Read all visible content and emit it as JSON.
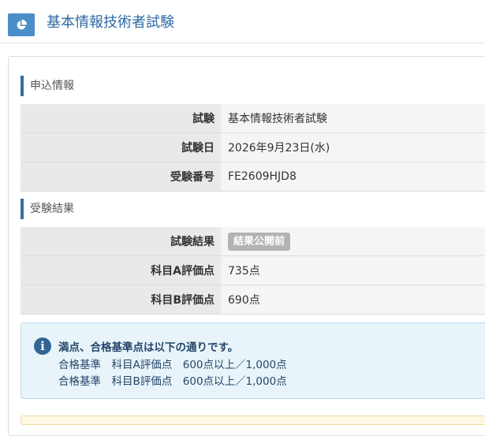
{
  "header": {
    "icon": "pie-chart-icon",
    "title": "基本情報技術者試験"
  },
  "application": {
    "heading": "申込情報",
    "rows": [
      {
        "label": "試験",
        "value": "基本情報技術者試験"
      },
      {
        "label": "試験日",
        "value": "2026年9月23日(水)"
      },
      {
        "label": "受験番号",
        "value": "FE2609HJD8"
      }
    ]
  },
  "results": {
    "heading": "受験結果",
    "status_label": "試験結果",
    "status_badge": "結果公開前",
    "rows": [
      {
        "label": "科目A評価点",
        "value": "735点"
      },
      {
        "label": "科目B評価点",
        "value": "690点"
      }
    ]
  },
  "notice": {
    "icon": "info-icon",
    "title": "満点、合格基準点は以下の通りです。",
    "lines": [
      "合格基準　科目A評価点　600点以上／1,000点",
      "合格基準　科目B評価点　600点以上／1,000点"
    ]
  },
  "colors": {
    "accent": "#2f6ea8",
    "header_icon_bg": "#4b8ec8",
    "badge_bg": "#b3b3b3",
    "notice_bg": "#e8f4fa"
  }
}
